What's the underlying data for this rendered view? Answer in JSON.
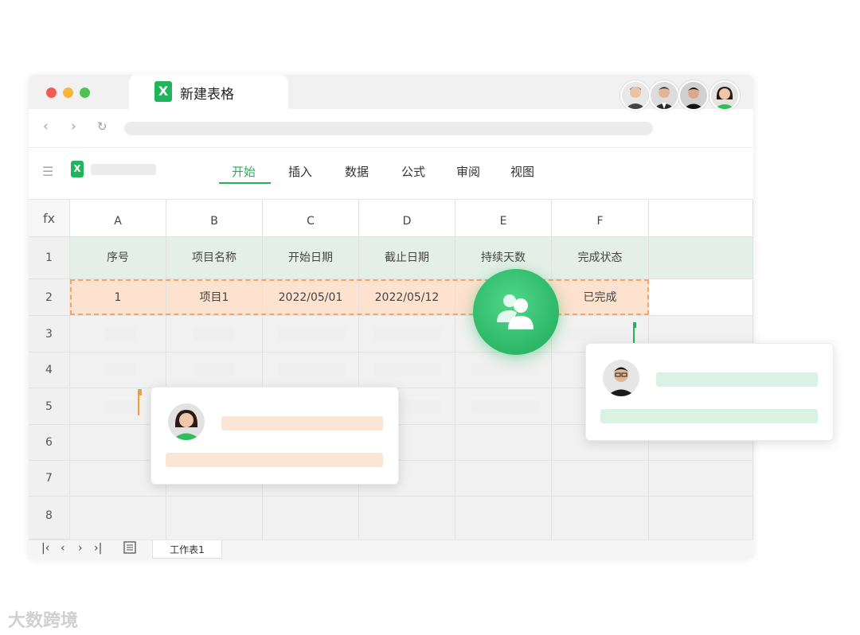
{
  "window": {
    "tab_title": "新建表格",
    "tab_icon": "spreadsheet-icon",
    "traffic": [
      "#ee5e56",
      "#f4b73c",
      "#4fc155"
    ]
  },
  "toolbar": {
    "tabs": [
      "开始",
      "插入",
      "数据",
      "公式",
      "审阅",
      "视图"
    ],
    "active_tab": "开始"
  },
  "sheet": {
    "fx": "fx",
    "columns": [
      "A",
      "B",
      "C",
      "D",
      "E",
      "F"
    ],
    "rows": [
      "1",
      "2",
      "3",
      "4",
      "5",
      "6",
      "7",
      "8"
    ],
    "header_row": [
      "序号",
      "项目名称",
      "开始日期",
      "截止日期",
      "持续天数",
      "完成状态"
    ],
    "data_row": [
      "1",
      "项目1",
      "2022/05/01",
      "2022/05/12",
      "",
      "已完成"
    ]
  },
  "statusbar": {
    "sheet_tab": "工作表1"
  },
  "colors": {
    "accent": "#22b35e",
    "header_row_bg": "#e4f0e7",
    "selected_row_bg": "#fde2cf",
    "selected_border": "#f0a868"
  },
  "watermark": "大数跨境"
}
